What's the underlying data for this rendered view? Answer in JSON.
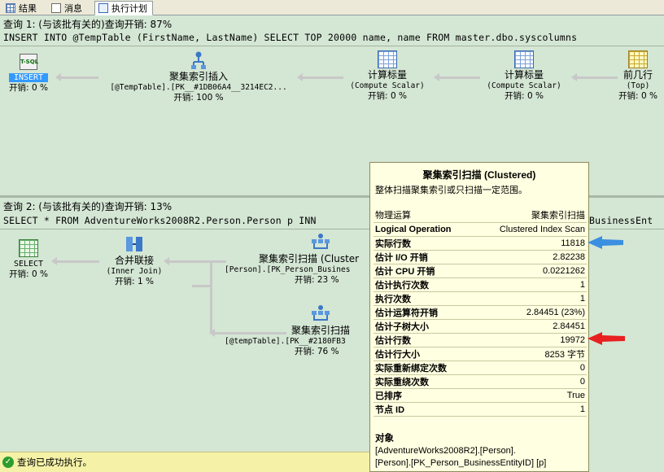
{
  "tabs": [
    {
      "label": "结果",
      "icon": "results-grid-icon"
    },
    {
      "label": "消息",
      "icon": "messages-icon"
    },
    {
      "label": "执行计划",
      "icon": "execution-plan-icon"
    }
  ],
  "query1": {
    "header": "查询 1: (与该批有关的)查询开销: 87%",
    "sql": "INSERT INTO @TempTable (FirstName, LastName) SELECT TOP 20000 name, name FROM master.dbo.syscolumns",
    "nodes": {
      "insert": {
        "icon_text": "T-SQL",
        "label": "INSERT",
        "cost": "开销: 0 %"
      },
      "ci_insert": {
        "name": "聚集索引插入",
        "sub": "[@TempTable].[PK__#1DB06A4__3214EC2...",
        "cost": "开销: 100 %"
      },
      "scalar1": {
        "name": "计算标量",
        "sub": "(Compute Scalar)",
        "cost": "开销: 0 %"
      },
      "scalar2": {
        "name": "计算标量",
        "sub": "(Compute Scalar)",
        "cost": "开销: 0 %"
      },
      "top": {
        "name": "前几行",
        "sub": "(Top)",
        "cost": "开销: 0 %"
      }
    }
  },
  "query2": {
    "header": "查询 2: (与该批有关的)查询开销: 13%",
    "sql": "SELECT * FROM AdventureWorks2008R2.Person.Person p INN",
    "sql_tail": "BusinessEnt",
    "nodes": {
      "select": {
        "name": "SELECT",
        "cost": "开销: 0 %"
      },
      "merge": {
        "name": "合并联接",
        "sub": "(Inner Join)",
        "cost": "开销: 1 %"
      },
      "scan1": {
        "name": "聚集索引扫描 (Cluster",
        "sub": "[Person].[PK_Person_Busines",
        "cost": "开销: 23 %"
      },
      "scan2": {
        "name": "聚集索引扫描",
        "sub": "[@tempTable].[PK__#2180FB3",
        "cost": "开销: 76 %"
      }
    }
  },
  "tooltip": {
    "title": "聚集索引扫描 (Clustered)",
    "desc": "整体扫描聚集索引或只扫描一定范围。",
    "rows": [
      {
        "k": "物理运算",
        "v": "聚集索引扫描",
        "bold": false
      },
      {
        "k": "Logical Operation",
        "v": "Clustered Index Scan",
        "bold": true
      },
      {
        "k": "实际行数",
        "v": "11818",
        "bold": true
      },
      {
        "k": "估计 I/O 开销",
        "v": "2.82238",
        "bold": true
      },
      {
        "k": "估计 CPU 开销",
        "v": "0.0221262",
        "bold": true
      },
      {
        "k": "估计执行次数",
        "v": "1",
        "bold": true
      },
      {
        "k": "执行次数",
        "v": "1",
        "bold": true
      },
      {
        "k": "估计运算符开销",
        "v": "2.84451 (23%)",
        "bold": true
      },
      {
        "k": "估计子树大小",
        "v": "2.84451",
        "bold": true
      },
      {
        "k": "估计行数",
        "v": "19972",
        "bold": true
      },
      {
        "k": "估计行大小",
        "v": "8253 字节",
        "bold": true
      },
      {
        "k": "实际重新绑定次数",
        "v": "0",
        "bold": true
      },
      {
        "k": "实际重绕次数",
        "v": "0",
        "bold": true
      },
      {
        "k": "已排序",
        "v": "True",
        "bold": true
      },
      {
        "k": "节点 ID",
        "v": "1",
        "bold": true
      }
    ],
    "object_label": "对象",
    "object_line1": "[AdventureWorks2008R2].[Person].",
    "object_line2": "[Person].[PK_Person_BusinessEntityID] [p]"
  },
  "annotations": {
    "blue_arrow_color": "#3b8fe0",
    "red_arrow_color": "#e82020"
  },
  "status": {
    "text": "查询已成功执行。"
  }
}
